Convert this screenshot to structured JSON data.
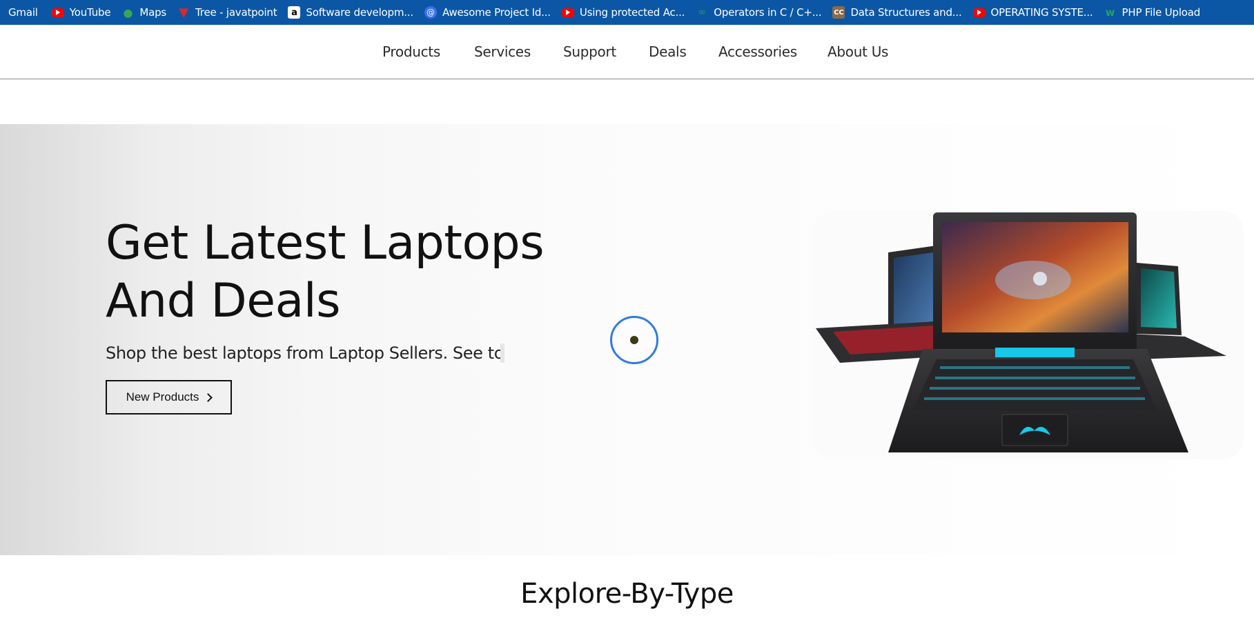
{
  "bookmarks": [
    {
      "label": "Gmail",
      "icon": "gmail-icon"
    },
    {
      "label": "YouTube",
      "icon": "youtube-icon"
    },
    {
      "label": "Maps",
      "icon": "maps-icon"
    },
    {
      "label": "Tree - javatpoint",
      "icon": "javatpoint-icon"
    },
    {
      "label": "Software developm...",
      "icon": "amazon-icon"
    },
    {
      "label": "Awesome Project Id...",
      "icon": "at-sign-icon"
    },
    {
      "label": "Using protected Ac...",
      "icon": "youtube-icon"
    },
    {
      "label": "Operators in C / C+...",
      "icon": "geeksforgeeks-icon"
    },
    {
      "label": "Data Structures and...",
      "icon": "cc-icon"
    },
    {
      "label": "OPERATING SYSTE...",
      "icon": "youtube-icon"
    },
    {
      "label": "PHP File Upload",
      "icon": "w3schools-icon"
    }
  ],
  "nav": {
    "items": [
      "Products",
      "Services",
      "Support",
      "Deals",
      "Accessories",
      "About Us"
    ]
  },
  "hero": {
    "title_line1": "Get Latest Laptops",
    "title_line2": "And Deals",
    "subtitle": "Shop the best laptops from Laptop Sellers. See top lap",
    "button_label": "New Products",
    "image_alt": "Gaming laptops"
  },
  "section": {
    "title": "Explore-By-Type"
  },
  "colors": {
    "bookmarks_bg": "#0b57a5",
    "cursor_ring": "#2f7be0",
    "accent_cyan": "#18c8e8"
  }
}
